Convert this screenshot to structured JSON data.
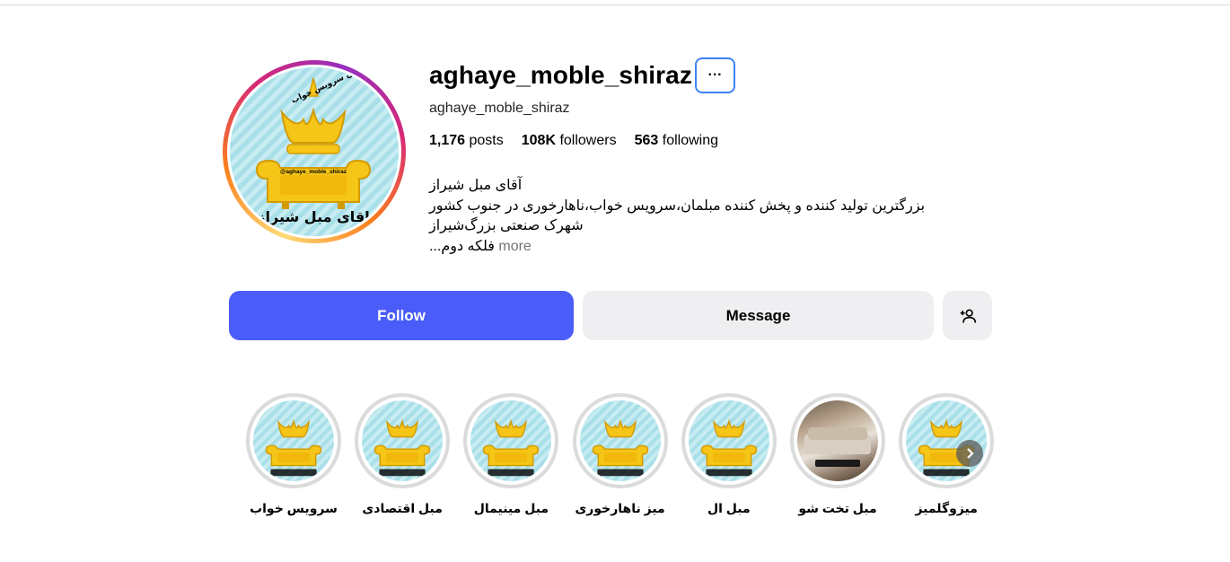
{
  "profile": {
    "username": "aghaye_moble_shiraz",
    "handle": "aghaye_moble_shiraz",
    "more_button": "···",
    "stats": {
      "posts_count": "1,176",
      "posts_label": "posts",
      "followers_count": "108K",
      "followers_label": "followers",
      "following_count": "563",
      "following_label": "following"
    },
    "bio": {
      "line1": "آقای مبل شیراز",
      "line2": "بزرگترین تولید کننده و پخش کننده مبلمان،سرویس خواب،ناهارخوری در جنوب کشور",
      "line3": "شهرک صنعتی بزرگ‌شیراز",
      "line4": "فلکه دوم...",
      "more": "more"
    },
    "avatar_text": {
      "top": "انواع مبلمان سرویس خواب",
      "handle": "@aghaye_moble_shiraz",
      "brand": "اقای مبل شیراز"
    }
  },
  "actions": {
    "follow": "Follow",
    "message": "Message"
  },
  "highlights": [
    {
      "label": "سرویس خواب",
      "type": "logo"
    },
    {
      "label": "مبل اقتصادی",
      "type": "logo"
    },
    {
      "label": "مبل مینیمال",
      "type": "logo"
    },
    {
      "label": "میز ناهارخوری",
      "type": "logo"
    },
    {
      "label": "مبل ال",
      "type": "logo"
    },
    {
      "label": "مبل تخت شو",
      "type": "photo"
    },
    {
      "label": "میزوگلمیز",
      "type": "logo"
    }
  ],
  "colors": {
    "follow_bg": "#4a5df9",
    "secondary_bg": "#efeff2",
    "logo_yellow": "#f5c518",
    "logo_bg": "#a8dfe8"
  },
  "icons": {
    "add_user": "add-user-icon",
    "next": "chevron-right-icon"
  }
}
